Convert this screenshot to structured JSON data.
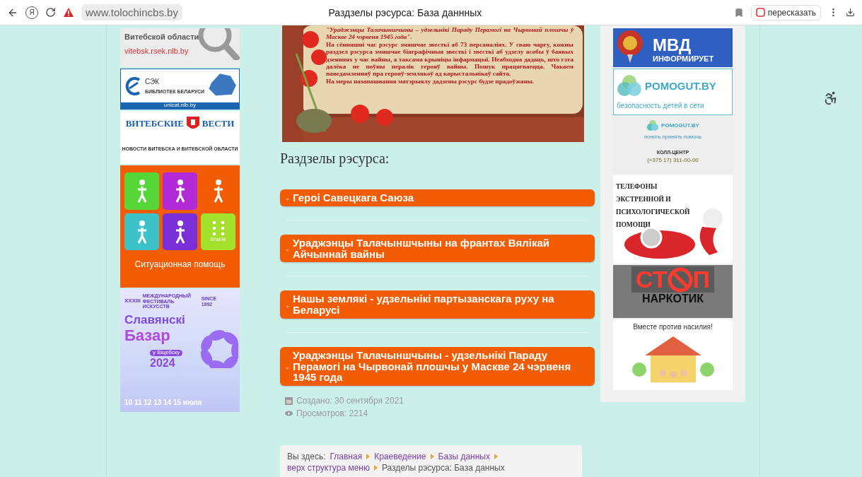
{
  "browser": {
    "home_glyph": "Я",
    "url": "www.tolochincbs.by",
    "title": "Раздзелы рэсурса: База даннных",
    "retell": "пересказать"
  },
  "left_banners": [
    {
      "kind": "region",
      "lines": [
        "Витебской области",
        "vitebsk.rsek.nlb.by"
      ]
    },
    {
      "kind": "sek",
      "lines": [
        "СЭК",
        "БИБЛИОТЕК БЕЛАРУСИ",
        "unicat.nlb.by"
      ]
    },
    {
      "kind": "vesti",
      "lines": [
        "ВИТЕБСКИЕ",
        "ВЕСТИ",
        "НОВОСТИ ВИТЕБСКА И ВИТЕБСКОЙ ОБЛАСТИ"
      ]
    },
    {
      "kind": "access",
      "lines": [
        "Braille",
        "Ситуационная помощь"
      ]
    },
    {
      "kind": "festival",
      "lines": [
        "XXXIII",
        "МЕЖДУНАРОДНЫЙ ФЕСТИВАЛЬ ИСКУССТВ",
        "SINCE 1992",
        "Славянскі",
        "Базар",
        "у Віцебску",
        "2024",
        "10 11 12 13 14 15 июля"
      ]
    }
  ],
  "article": {
    "hero": {
      "title": "\"Ураджэнцы Талачыншчыны – удзельнікі Параду Перамогі на Чырвонай плошчы ў Маскве 24 чэрвеня 1945 года\".",
      "paragraphs": [
        "На сённяшні час рэсурс змяшчае звесткі аб 73 персаналіях. У сваю чаргу, кожны раздзел рэсурса змяшчае біяграфічныя звесткі і звесткі аб удзелу асобы ў баявых дзеяннях у час вайны, а таксама крыніцы інфармацыі. Неабходна дадаць, што гэта далёка не поўны пералік герояў вайны. Пошук працягваецца. Чакаем паведамленняў пра герояў-землякоў ад карыстальнікаў сайта.",
        "На меры назапашвання матэрыялу дадзены рэсурс будзе прадоўжаны."
      ]
    },
    "heading": "Раздзелы рэсурса:",
    "sections": [
      {
        "title": "Героі Савецкага Саюза",
        "expanded": false
      },
      {
        "title": "Ураджэнцы Талачыншчыны на франтах Вялікай Айчыннай вайны",
        "expanded": false
      },
      {
        "title": "Нашы землякі - удзельнікі партызанскага руху на Беларусі",
        "expanded": false
      },
      {
        "title": "Ураджэнцы Талачыншчыны - удзельнікі Параду Перамогі на Чырвонай плошчы у Маскве 24 чэрвеня 1945 года",
        "expanded": false
      }
    ],
    "created": "Создано: 30 сентября 2021",
    "views": "Просмотров: 2214",
    "breadcrumb": {
      "label": "Вы здесь:",
      "items": [
        {
          "text": "Главная",
          "link": true
        },
        {
          "text": "Краеведение",
          "link": true
        },
        {
          "text": "Базы данных",
          "link": true
        },
        {
          "text": "верх структура меню",
          "link": true
        },
        {
          "text": "Разделы рэсурса: База данных",
          "link": false
        }
      ]
    }
  },
  "right_banners": [
    {
      "kind": "mvd",
      "lines": [
        "МВД",
        "ИНФОРМИРУЕТ"
      ]
    },
    {
      "kind": "pomogut",
      "lines": [
        "POMOGUT.BY",
        "безопасность детей в сети"
      ]
    },
    {
      "kind": "pomogut_info",
      "lines": [
        "POMOGUT.BY",
        "понять принять помочь",
        "КОЛЛ-ЦЕНТР",
        "(+375 17) 311-00-00"
      ]
    },
    {
      "kind": "phones",
      "lines": [
        "ТЕЛЕФОНЫ ЭКСТРЕННОЙ И ПСИХОЛОГИЧЕСКОЙ ПОМОЩИ"
      ]
    },
    {
      "kind": "stop",
      "lines": [
        "СТ",
        "П",
        "НАРКОТИК"
      ]
    },
    {
      "kind": "violence",
      "lines": [
        "Вместе против насилия!"
      ]
    }
  ]
}
